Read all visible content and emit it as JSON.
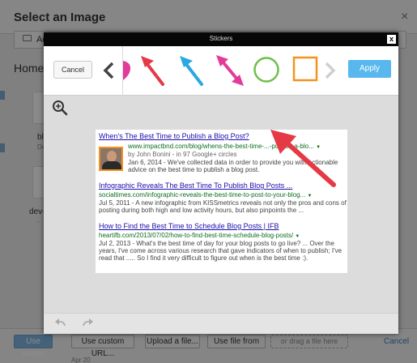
{
  "background": {
    "title": "Select an Image",
    "close": "×",
    "toolbar_label": "Acti",
    "breadcrumb": "Home /",
    "files": [
      {
        "name": "bl",
        "sub": "De"
      },
      {
        "name": "dev-h",
        "sub": "-"
      }
    ],
    "buttons": {
      "use_image": "Use image",
      "custom_url": "Use custom URL...",
      "upload": "Upload a file...",
      "from": "Use file from",
      "drop": "or drag a file here",
      "cancel": "Cancel"
    },
    "footer": "Apr 20"
  },
  "modal": {
    "title": "Stickers",
    "close": "x",
    "cancel_label": "Cancel",
    "apply_label": "Apply",
    "stickers": [
      "heart-sticker",
      "red-arrow-sticker",
      "blue-arrow-sticker",
      "pink-double-arrow-sticker",
      "green-circle-sticker",
      "orange-square-sticker"
    ],
    "colors": {
      "red": "#e53a45",
      "blue": "#2aa8e0",
      "pink": "#e33b9a",
      "green": "#6fc04b",
      "orange": "#f4921f",
      "apply": "#58b8ee"
    }
  },
  "result": {
    "items": [
      {
        "title": "When's The Best Time to Publish a Blog Post?",
        "url": "www.impactbnd.com/blog/whens-the-best-time-...-publish-a-blo...",
        "by": "by John Bonini - in 97 Google+ circles",
        "snippet": [
          "Jan 6, 2014 - We've collected data in order to provide you with actionable",
          "advice on the best time to publish a blog post."
        ]
      },
      {
        "title": "Infographic Reveals The Best Time To Publish Blog Posts ...",
        "url": "socialtimes.com/infographic-reveals-the-best-time-to-post-to-your-blog...",
        "snippet": [
          "Jul 5, 2011 - A new infographic from KISSmetrics reveals not only the pros and cons of",
          "posting during both high and low activity hours, but also pinpoints the ..."
        ]
      },
      {
        "title": "How to Find the Best Time to Schedule Blog Posts | IFB",
        "url": "heartifb.com/2013/07/02/how-to-find-best-time-schedule-blog-posts/",
        "snippet": [
          "Jul 2, 2013 - What's the best time of day for your blog posts to go live? ... Over the",
          "years, I've come across various research that gave indicators of when to publish; I've",
          "read that ..... So I find it very difficult to figure out when is the best time :)."
        ]
      }
    ]
  }
}
